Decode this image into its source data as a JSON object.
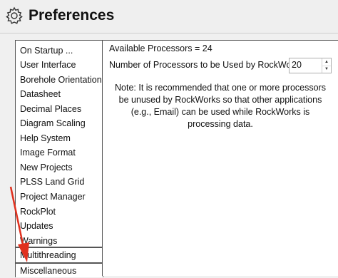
{
  "window": {
    "title": "Preferences",
    "icon": "gear-icon"
  },
  "sidebar": {
    "items": [
      {
        "label": "On Startup ..."
      },
      {
        "label": "User Interface"
      },
      {
        "label": "Borehole Orientations"
      },
      {
        "label": "Datasheet"
      },
      {
        "label": "Decimal Places"
      },
      {
        "label": "Diagram Scaling"
      },
      {
        "label": "Help System"
      },
      {
        "label": "Image Format"
      },
      {
        "label": "New Projects"
      },
      {
        "label": "PLSS Land Grid"
      },
      {
        "label": "Project Manager"
      },
      {
        "label": "RockPlot"
      },
      {
        "label": "Updates"
      },
      {
        "label": "Warnings"
      },
      {
        "label": "Multithreading"
      },
      {
        "label": "Miscellaneous"
      }
    ],
    "selected": "Multithreading"
  },
  "main": {
    "available_processors": "Available Processors = 24",
    "num_processors_label": "Number of Processors to be Used by RockWorks",
    "num_processors_value": "20",
    "note": "Note: It is recommended that one or more processors be unused by RockWorks so that other applications (e.g., Email) can be used while RockWorks is processing data."
  },
  "annotation": {
    "arrow_color": "#e0301e",
    "arrow_icon": "red-arrow-icon"
  }
}
